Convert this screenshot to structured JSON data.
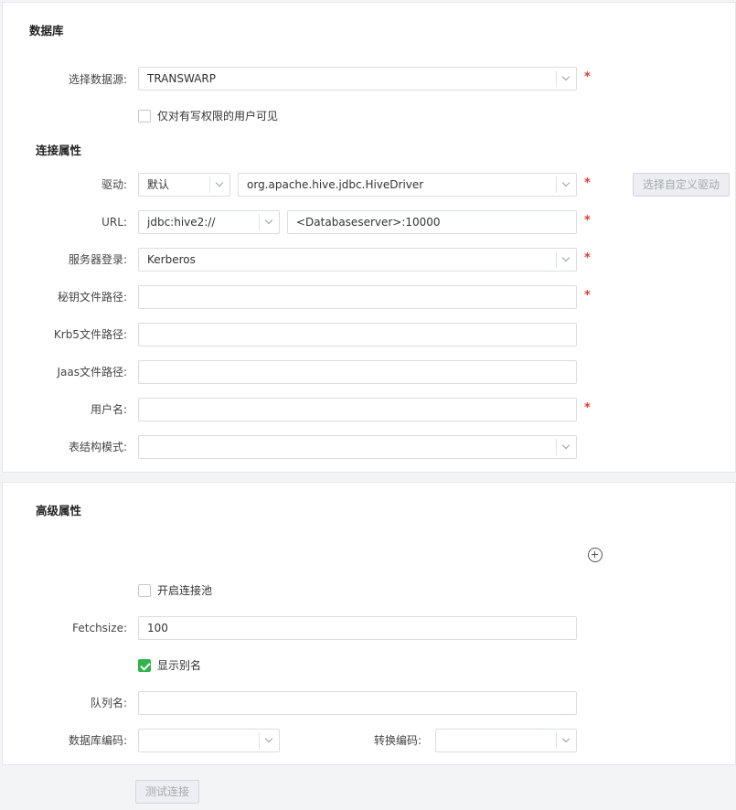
{
  "database_section": {
    "title": "数据库",
    "datasource": {
      "label": "选择数据源:",
      "value": "TRANSWARP"
    },
    "write_permission_checkbox": {
      "label": "仅对有写权限的用户可见",
      "checked": false
    }
  },
  "connection": {
    "title": "连接属性",
    "driver": {
      "label": "驱动:",
      "type_value": "默认",
      "class_value": "org.apache.hive.jdbc.HiveDriver",
      "custom_button": "选择自定义驱动"
    },
    "url": {
      "label": "URL:",
      "prefix_value": "jdbc:hive2://",
      "server_value": "<Databaseserver>:10000"
    },
    "server_login": {
      "label": "服务器登录:",
      "value": "Kerberos"
    },
    "keytab_path": {
      "label": "秘钥文件路径:",
      "value": ""
    },
    "krb5_path": {
      "label": "Krb5文件路径:",
      "value": ""
    },
    "jaas_path": {
      "label": "Jaas文件路径:",
      "value": ""
    },
    "username": {
      "label": "用户名:",
      "value": ""
    },
    "schema": {
      "label": "表结构模式:",
      "value": ""
    },
    "required_mark": "*"
  },
  "advanced": {
    "title": "高级属性",
    "pool_checkbox": {
      "label": "开启连接池",
      "checked": false
    },
    "fetchsize": {
      "label": "Fetchsize:",
      "value": "100"
    },
    "alias_checkbox": {
      "label": "显示别名",
      "checked": true
    },
    "queue_name": {
      "label": "队列名:",
      "value": ""
    },
    "db_encoding": {
      "label": "数据库编码:",
      "value": ""
    },
    "convert_encoding": {
      "label": "转换编码:",
      "value": ""
    },
    "add_icon": "plus-circle-icon"
  },
  "footer": {
    "test_button": "测试连接"
  },
  "colors": {
    "required": "#e53935",
    "check_on": "#2fb34a"
  }
}
